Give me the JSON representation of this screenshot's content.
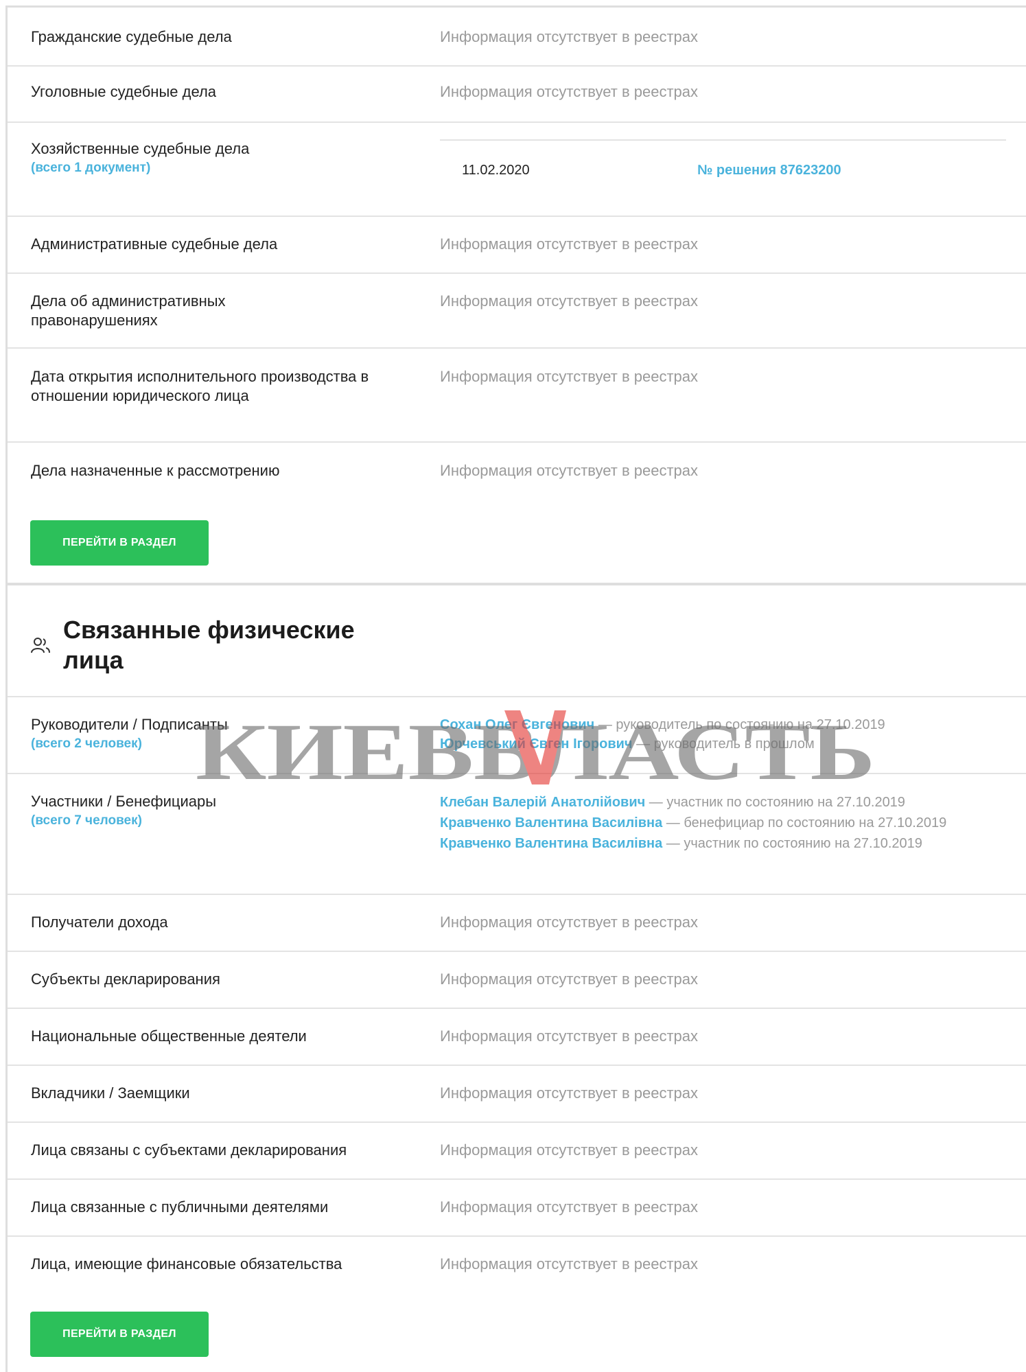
{
  "court": {
    "rows": [
      {
        "label": "Гражданские судебные дела",
        "value": "Информация отсутствует в реестрах"
      },
      {
        "label": "Уголовные судебные дела",
        "value": "Информация отсутствует в реестрах"
      },
      {
        "label": "Хозяйственные судебные дела",
        "sub": "(всего 1 документ)",
        "date": "11.02.2020",
        "decision": "№ решения 87623200"
      },
      {
        "label": "Административные судебные дела",
        "value": "Информация отсутствует в реестрах"
      },
      {
        "label": "Дела об административных правонарушениях",
        "value": "Информация отсутствует в реестрах"
      },
      {
        "label": "Дата открытия исполнительного производства в отношении юридического лица",
        "value": "Информация отсутствует в реестрах"
      },
      {
        "label": "Дела назначенные к рассмотрению",
        "value": "Информация отсутствует в реестрах"
      }
    ],
    "button": "ПЕРЕЙТИ В РАЗДЕЛ"
  },
  "persons": {
    "title": "Связанные физические лица",
    "icon": "people-icon",
    "managers": {
      "label": "Руководители / Подписанты",
      "sub": "(всего 2 человек)",
      "entries": [
        {
          "name": "Сохан Олег Євгенович",
          "role": " — руководитель по состоянию на 27.10.2019"
        },
        {
          "name": "Юрчевський Євген Ігорович",
          "role": " — руководитель в прошлом"
        }
      ]
    },
    "participants": {
      "label": "Участники / Бенефициары",
      "sub": "(всего 7 человек)",
      "entries": [
        {
          "name": "Клебан Валерій Анатолійович",
          "role": " — участник по состоянию на 27.10.2019"
        },
        {
          "name": "Кравченко Валентина Василівна",
          "role": " — бенефициар по состоянию на 27.10.2019"
        },
        {
          "name": "Кравченко Валентина Василівна",
          "role": " — участник по состоянию на 27.10.2019"
        }
      ]
    },
    "rows": [
      {
        "label": "Получатели дохода",
        "value": "Информация отсутствует в реестрах"
      },
      {
        "label": "Субъекты декларирования",
        "value": "Информация отсутствует в реестрах"
      },
      {
        "label": "Национальные общественные деятели",
        "value": "Информация отсутствует в реестрах"
      },
      {
        "label": "Вкладчики / Заемщики",
        "value": "Информация отсутствует в реестрах"
      },
      {
        "label": "Лица связаны с субъектами декларирования",
        "value": "Информация отсутствует в реестрах"
      },
      {
        "label": "Лица связанные с публичными деятелями",
        "value": "Информация отсутствует в реестрах"
      },
      {
        "label": "Лица, имеющие финансовые обязательства",
        "value": "Информация отсутствует в реестрах"
      }
    ],
    "button": "ПЕРЕЙТИ В РАЗДЕЛ"
  },
  "watermark": {
    "text": "КИЕВВЛАСТЬ",
    "color": "#6f6f6f",
    "accent": "#e53935"
  }
}
